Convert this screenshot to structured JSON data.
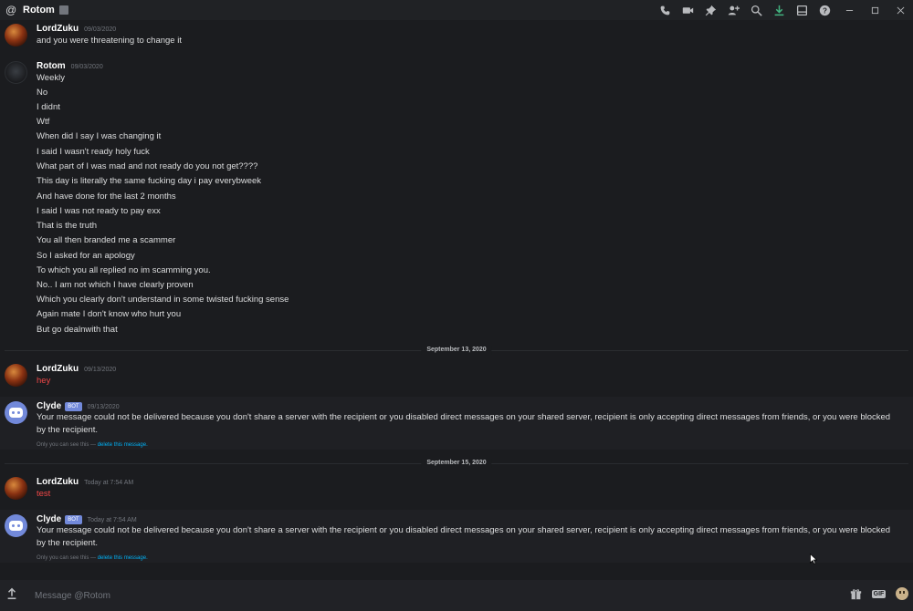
{
  "titlebar": {
    "channel": "Rotom",
    "icons": [
      "call-icon",
      "video-icon",
      "pin-icon",
      "add-friend-icon",
      "search-icon",
      "download-icon",
      "inbox-icon",
      "help-icon"
    ],
    "window": [
      "minimize-icon",
      "maximize-icon",
      "close-icon"
    ]
  },
  "messages": [
    {
      "user": "LordZuku",
      "time": "09/03/2020",
      "lines": [
        "and you were threatening to change it"
      ]
    },
    {
      "user": "Rotom",
      "time": "09/03/2020",
      "lines": [
        "Weekly",
        "No",
        "I didnt",
        "Wtf",
        "When did I say I was changing it",
        "I said I wasn't ready holy fuck",
        "What part of I was mad and not ready do you not get????",
        "This day is literally the same fucking day i pay everybweek",
        "And have done for the last 2 months",
        "I said I was not ready to pay exx",
        "That is the truth",
        "You all then branded me a scammer",
        "So I asked for an apology",
        "To which you all replied no im scamming you.",
        "No.. I am not which I have clearly proven",
        "Which you clearly don't understand in some twisted fucking sense",
        "Again mate I don't know who hurt you",
        "But go dealnwith that"
      ]
    },
    {
      "divider": "September 13, 2020"
    },
    {
      "user": "LordZuku",
      "time": "09/13/2020",
      "lines": [
        "hey"
      ]
    },
    {
      "user": "Clyde",
      "bot_tag": "BOT",
      "time": "09/13/2020",
      "text": "Your message could not be delivered because you don't share a server with the recipient or you disabled direct messages on your shared server, recipient is only accepting direct messages from friends, or you were blocked by the recipient.",
      "ephemeral": "Only you can see this —",
      "delete_link": "delete this message."
    },
    {
      "divider": "September 15, 2020"
    },
    {
      "user": "LordZuku",
      "time": "Today at 7:54 AM",
      "lines": [
        "test"
      ]
    },
    {
      "user": "Clyde",
      "bot_tag": "BOT",
      "time": "Today at 7:54 AM",
      "text": "Your message could not be delivered because you don't share a server with the recipient or you disabled direct messages on your shared server, recipient is only accepting direct messages from friends, or you were blocked by the recipient.",
      "ephemeral": "Only you can see this —",
      "delete_link": "delete this message."
    }
  ],
  "composer": {
    "placeholder": "Message @Rotom",
    "gif_label": "GIF",
    "icons": [
      "upload-icon",
      "gift-icon",
      "gif-icon",
      "emoji-icon"
    ]
  },
  "colors": {
    "accent": "#7289da",
    "mention_red": "#f04747",
    "link": "#00b0f4"
  }
}
